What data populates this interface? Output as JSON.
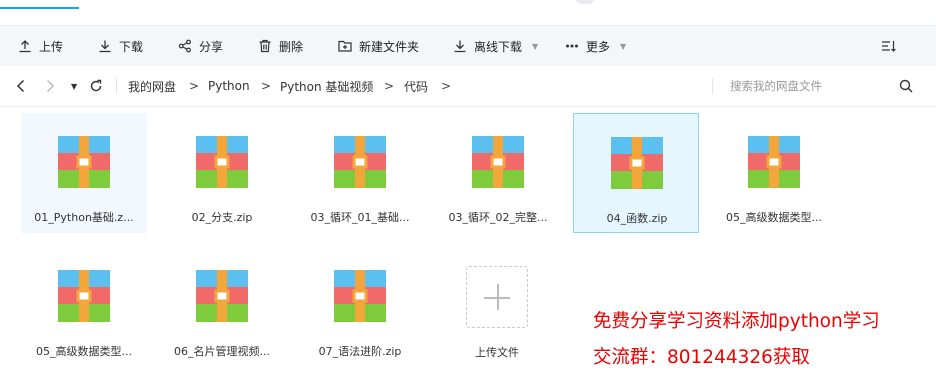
{
  "toolbar": {
    "upload": "上传",
    "download": "下载",
    "share": "分享",
    "delete": "删除",
    "new_folder": "新建文件夹",
    "offline_download": "离线下载",
    "more": "更多"
  },
  "breadcrumb": {
    "items": [
      "我的网盘",
      "Python",
      "Python 基础视频",
      "代码"
    ],
    "separator": ">"
  },
  "search": {
    "placeholder": "搜索我的网盘文件"
  },
  "files": [
    {
      "name": "01_Python基础.z...",
      "state": "hover"
    },
    {
      "name": "02_分支.zip",
      "state": ""
    },
    {
      "name": "03_循环_01_基础...",
      "state": ""
    },
    {
      "name": "03_循环_02_完整...",
      "state": ""
    },
    {
      "name": "04_函数.zip",
      "state": "selected"
    },
    {
      "name": "05_高级数据类型...",
      "state": ""
    },
    {
      "name": "05_高级数据类型...",
      "state": ""
    },
    {
      "name": "06_名片管理视频...",
      "state": ""
    },
    {
      "name": "07_语法进阶.zip",
      "state": ""
    }
  ],
  "upload_tile": {
    "label": "上传文件"
  },
  "promo": {
    "line1": "免费分享学习资料添加python学习",
    "line2": "交流群：801244326获取"
  },
  "colors": {
    "accent": "#06a7ff",
    "promo": "#ee0000"
  }
}
